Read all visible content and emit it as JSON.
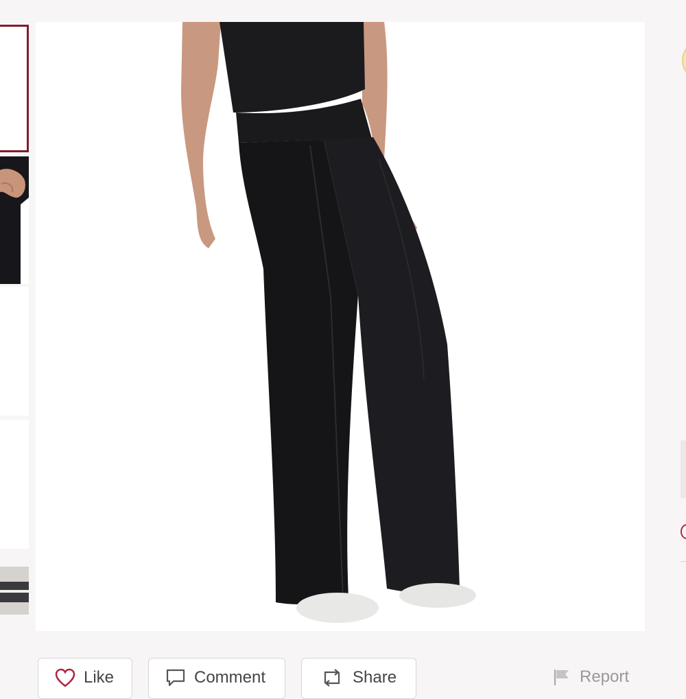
{
  "listing": {
    "image_alt": "Black wide-leg pants"
  },
  "actions": {
    "like_label": "Like",
    "comment_label": "Comment",
    "share_label": "Share",
    "report_label": "Report"
  },
  "colors": {
    "accent": "#7f1d2e",
    "page_background": "#f8f5f6",
    "like_heart": "#b0263f"
  }
}
